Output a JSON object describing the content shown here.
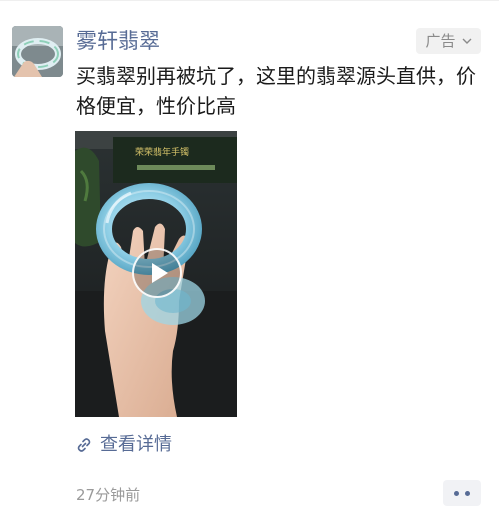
{
  "post": {
    "author_name": "雾轩翡翠",
    "ad_label": "广告",
    "ad_chevron_icon": "chevron-down-icon",
    "text": "买翡翠别再被坑了，这里的翡翠源头直供，价格便宜，性价比高",
    "video": {
      "thumbnail_subject": "hand-holding-jade-bangle",
      "play_icon": "play-icon",
      "background_sign_text": "荣荣翡年手镯"
    },
    "link": {
      "icon": "link-icon",
      "label": "查看详情"
    },
    "timestamp": "27分钟前",
    "more_icon": "more-dots-icon"
  },
  "colors": {
    "author_link": "#576b95",
    "text_primary": "#1a1a1a",
    "text_secondary": "#9a9a9a",
    "tag_background": "#f1f1f1",
    "jade": "#9fd6ea"
  }
}
